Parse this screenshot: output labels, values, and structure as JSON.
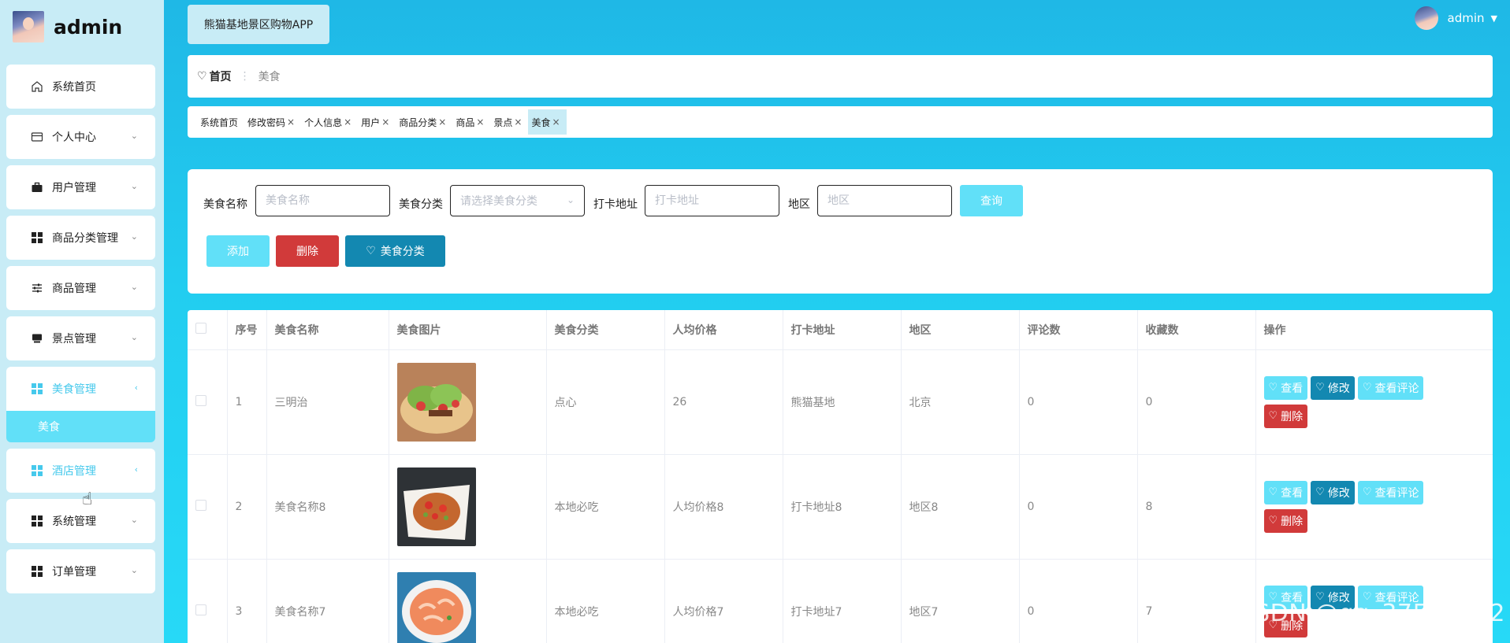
{
  "brand": {
    "title": "admin"
  },
  "header": {
    "app_title": "熊猫基地景区购物APP",
    "user_name": "admin"
  },
  "sidebar": {
    "items": [
      {
        "label": "系统首页",
        "icon": "home-icon"
      },
      {
        "label": "个人中心",
        "icon": "card-icon"
      },
      {
        "label": "用户管理",
        "icon": "briefcase-icon"
      },
      {
        "label": "商品分类管理",
        "icon": "grid-icon"
      },
      {
        "label": "商品管理",
        "icon": "sliders-icon"
      },
      {
        "label": "景点管理",
        "icon": "monitor-icon"
      },
      {
        "label": "美食管理",
        "icon": "grid-icon"
      },
      {
        "label": "酒店管理",
        "icon": "grid-icon"
      },
      {
        "label": "系统管理",
        "icon": "grid-icon"
      },
      {
        "label": "订单管理",
        "icon": "grid-icon"
      }
    ],
    "submenu_label": "美食"
  },
  "breadcrumb": {
    "home": "首页",
    "current": "美食"
  },
  "tabs": [
    {
      "label": "系统首页",
      "closable": false
    },
    {
      "label": "修改密码",
      "closable": true
    },
    {
      "label": "个人信息",
      "closable": true
    },
    {
      "label": "用户",
      "closable": true
    },
    {
      "label": "商品分类",
      "closable": true
    },
    {
      "label": "商品",
      "closable": true
    },
    {
      "label": "景点",
      "closable": true
    },
    {
      "label": "美食",
      "closable": true
    }
  ],
  "search": {
    "name_label": "美食名称",
    "name_placeholder": "美食名称",
    "category_label": "美食分类",
    "category_placeholder": "请选择美食分类",
    "address_label": "打卡地址",
    "address_placeholder": "打卡地址",
    "region_label": "地区",
    "region_placeholder": "地区",
    "query_button": "查询"
  },
  "actions": {
    "add": "添加",
    "delete": "删除",
    "category": "美食分类"
  },
  "table": {
    "headers": [
      "序号",
      "美食名称",
      "美食图片",
      "美食分类",
      "人均价格",
      "打卡地址",
      "地区",
      "评论数",
      "收藏数",
      "操作"
    ],
    "rows": [
      {
        "index": "1",
        "name": "三明治",
        "category": "点心",
        "price": "26",
        "address": "熊猫基地",
        "region": "北京",
        "comments": "0",
        "favorites": "0",
        "image": "tacos-photo"
      },
      {
        "index": "2",
        "name": "美食名称8",
        "category": "本地必吃",
        "price": "人均价格8",
        "address": "打卡地址8",
        "region": "地区8",
        "comments": "0",
        "favorites": "8",
        "image": "stirfry-photo"
      },
      {
        "index": "3",
        "name": "美食名称7",
        "category": "本地必吃",
        "price": "人均价格7",
        "address": "打卡地址7",
        "region": "地区7",
        "comments": "0",
        "favorites": "7",
        "image": "shrimp-photo"
      }
    ],
    "ops": {
      "view": "查看",
      "edit": "修改",
      "review": "查看评论",
      "delete": "删除"
    }
  },
  "watermark": "CSDN @qq_37527982",
  "colors": {
    "accent": "#61e0f8",
    "primary": "#1388b1",
    "danger": "#d13a3a",
    "sidebar_bg": "#c8ecf6",
    "bg_gradient": "#1fb8e6"
  }
}
